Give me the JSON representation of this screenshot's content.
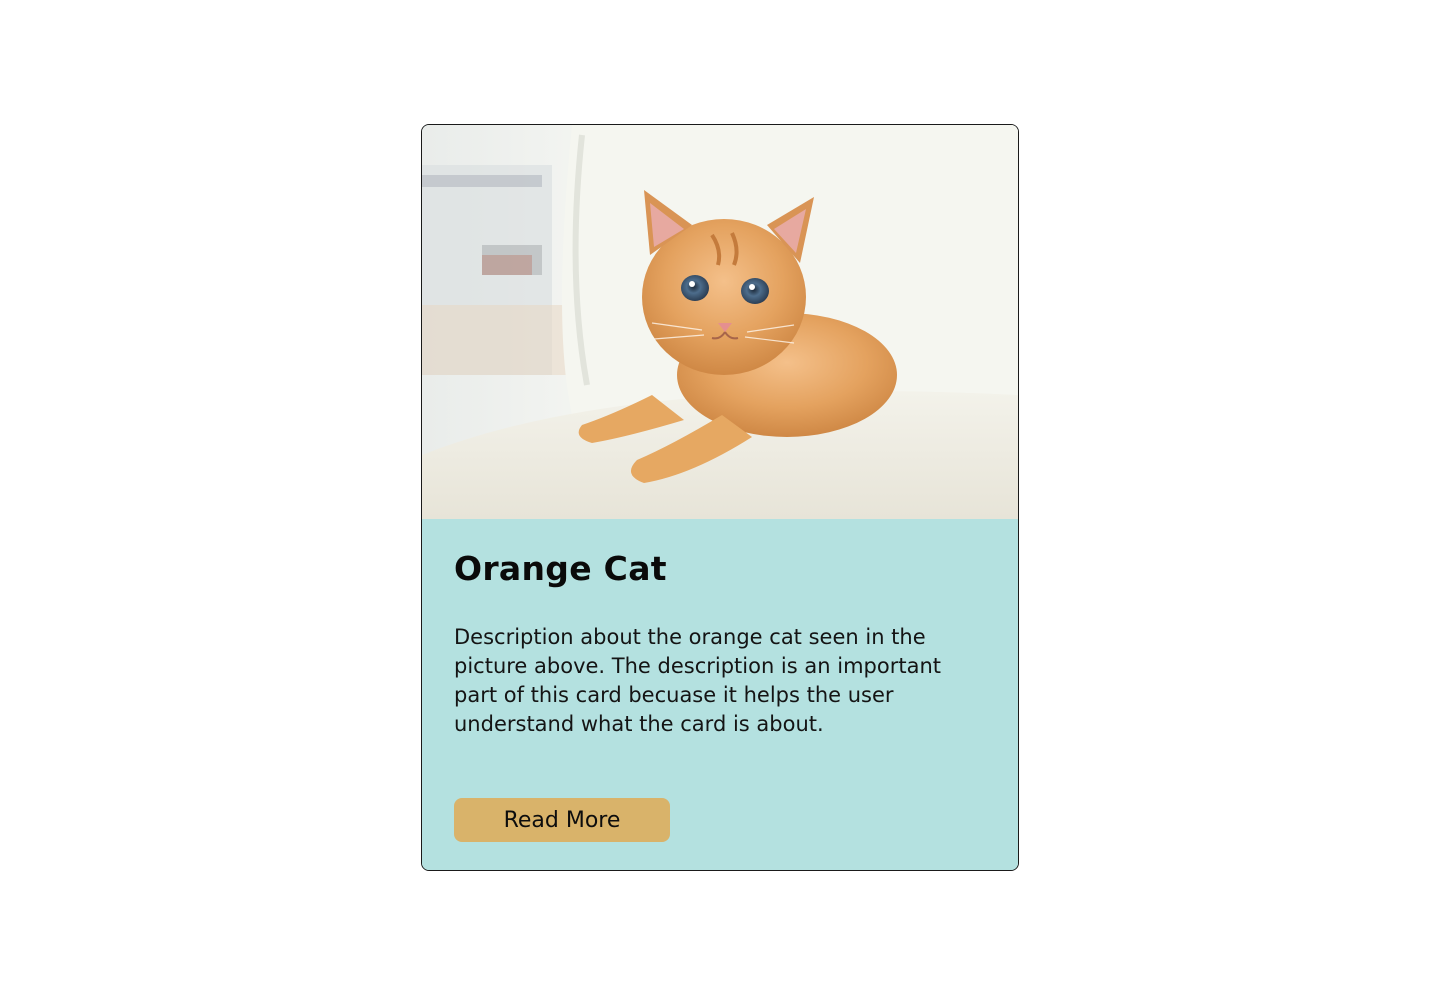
{
  "card": {
    "image_alt": "Orange kitten lying on a white couch",
    "title": "Orange Cat",
    "description": "Description about the orange cat seen in the picture above. The description is an important part of this card becuase it helps the user understand what the card is about.",
    "button_label": "Read More"
  },
  "colors": {
    "card_background": "#b4e1e0",
    "button_background": "#d9b36a",
    "text": "#0a0a0a"
  }
}
